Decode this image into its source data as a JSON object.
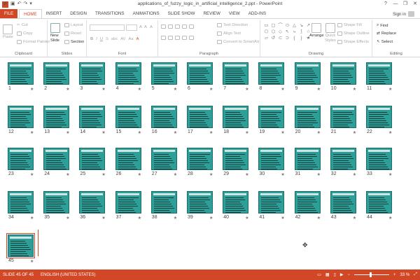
{
  "window": {
    "title": "applications_of_fuzzy_logic_in_artificial_intelligence_2.ppt - PowerPoint",
    "app_icon": "P",
    "controls": [
      "?",
      "—",
      "❐",
      "✕"
    ],
    "sign_in": "Sign in"
  },
  "qat": [
    "save-icon",
    "undo-icon",
    "redo-icon",
    "customize-icon"
  ],
  "tabs": {
    "file": "FILE",
    "home": "HOME",
    "insert": "INSERT",
    "design": "DESIGN",
    "transitions": "TRANSITIONS",
    "animations": "ANIMATIONS",
    "slideshow": "SLIDE SHOW",
    "review": "REVIEW",
    "view": "VIEW",
    "addins": "ADD-INS"
  },
  "ribbon": {
    "clipboard": {
      "label": "Clipboard",
      "paste": "Paste",
      "cut": "Cut",
      "copy": "Copy",
      "format_painter": "Format Painter"
    },
    "slides": {
      "label": "Slides",
      "new_slide": "New",
      "new_slide2": "Slide",
      "layout": "Layout",
      "reset": "Reset",
      "section": "Section"
    },
    "font": {
      "label": "Font",
      "bold": "B",
      "italic": "I",
      "underline": "U",
      "strike": "S",
      "shadow": "abc",
      "spacing": "AV",
      "case": "Aa",
      "grow": "A",
      "shrink": "A",
      "clear": "A",
      "color": "A"
    },
    "paragraph": {
      "label": "Paragraph",
      "text_direction": "Text Direction",
      "align_text": "Align Text",
      "convert_smartart": "Convert to SmartArt"
    },
    "drawing": {
      "label": "Drawing",
      "arrange": "Arrange",
      "quick_styles": "Quick",
      "quick_styles2": "Styles",
      "shape_fill": "Shape Fill",
      "shape_outline": "Shape Outline",
      "shape_effects": "Shape Effects",
      "shapes": [
        "▭",
        "▢",
        "⌒",
        "⬭",
        "△",
        "↘",
        "↗",
        "⬠",
        "⬡",
        "◇",
        "↖",
        "⤷",
        "⟆",
        "☆",
        "▱",
        "↺",
        "⊂",
        "⊃",
        "{",
        "}",
        "★"
      ]
    },
    "editing": {
      "label": "Editing",
      "find": "Find",
      "replace": "Replace",
      "select": "Select"
    }
  },
  "slides": [
    {
      "n": "1"
    },
    {
      "n": "2"
    },
    {
      "n": "3"
    },
    {
      "n": "4"
    },
    {
      "n": "5"
    },
    {
      "n": "6"
    },
    {
      "n": "7"
    },
    {
      "n": "8"
    },
    {
      "n": "9"
    },
    {
      "n": "10"
    },
    {
      "n": "11"
    },
    {
      "n": "12"
    },
    {
      "n": "13"
    },
    {
      "n": "14"
    },
    {
      "n": "15"
    },
    {
      "n": "16"
    },
    {
      "n": "17"
    },
    {
      "n": "18"
    },
    {
      "n": "19"
    },
    {
      "n": "20"
    },
    {
      "n": "21"
    },
    {
      "n": "22"
    },
    {
      "n": "23"
    },
    {
      "n": "24"
    },
    {
      "n": "25"
    },
    {
      "n": "26"
    },
    {
      "n": "27"
    },
    {
      "n": "28"
    },
    {
      "n": "29"
    },
    {
      "n": "30"
    },
    {
      "n": "31"
    },
    {
      "n": "32"
    },
    {
      "n": "33"
    },
    {
      "n": "34"
    },
    {
      "n": "35"
    },
    {
      "n": "36"
    },
    {
      "n": "37"
    },
    {
      "n": "38"
    },
    {
      "n": "39"
    },
    {
      "n": "40"
    },
    {
      "n": "41"
    },
    {
      "n": "42"
    },
    {
      "n": "43"
    },
    {
      "n": "44"
    },
    {
      "n": "45"
    }
  ],
  "status": {
    "slide": "SLIDE 45 OF 45",
    "language": "ENGLISH (UNITED STATES)",
    "zoom": "33 %"
  },
  "colors": {
    "accent": "#d24726",
    "slide_teal": "#2e9e99"
  }
}
